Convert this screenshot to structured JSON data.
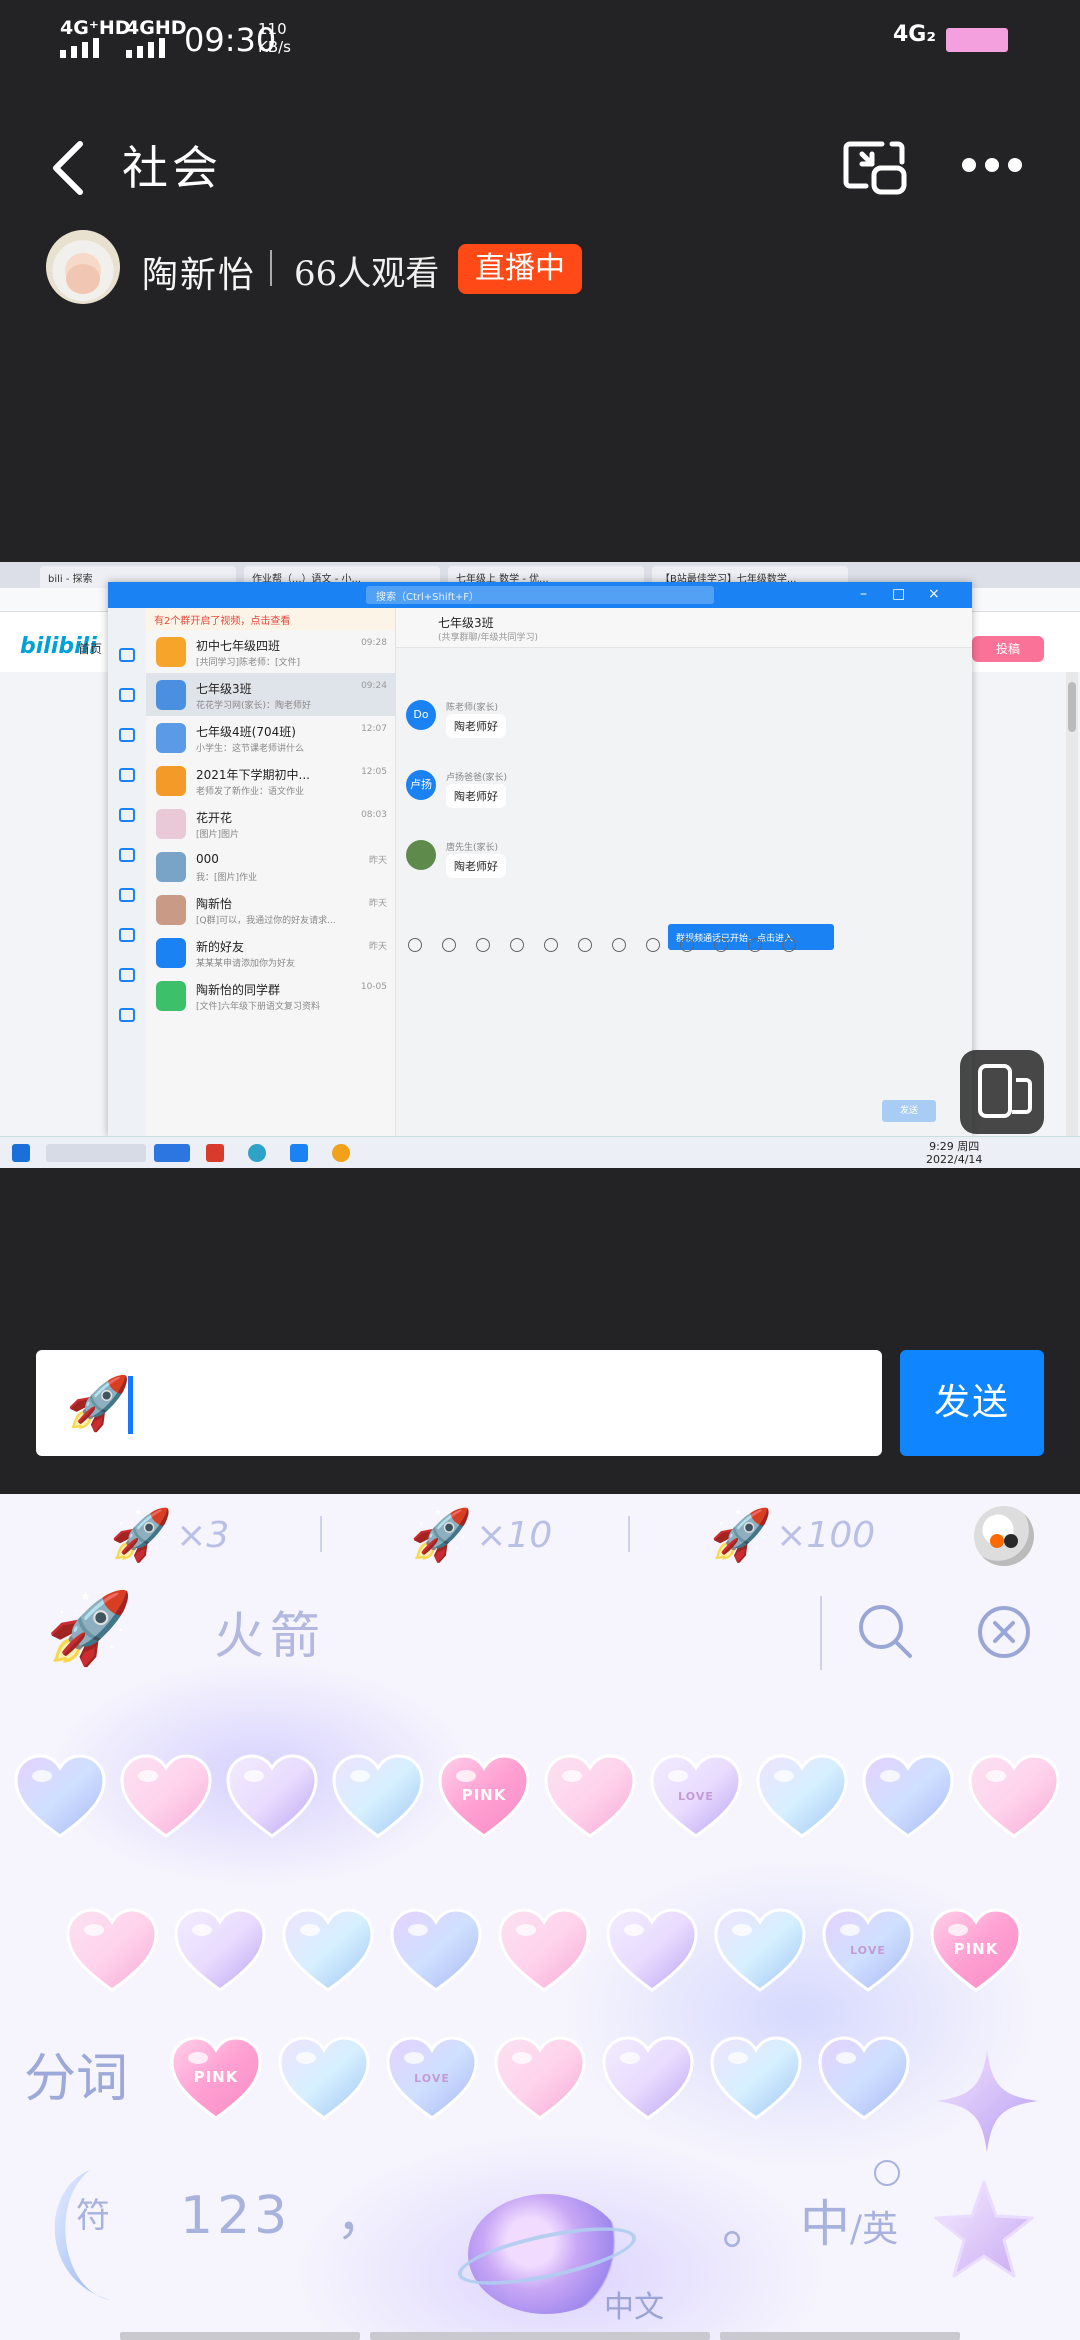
{
  "status_bar": {
    "net_left_1": "4G⁺HD",
    "net_left_2": "4GHD",
    "time": "09:30",
    "speed_value": "110",
    "speed_unit": "KB/s",
    "net_right": "4G₂",
    "battery_color": "#f4a0de"
  },
  "header": {
    "back_icon": "chevron-left-icon",
    "title": "社会",
    "pip_icon": "picture-in-picture-icon",
    "more_icon": "more-dots-icon"
  },
  "streamer": {
    "name": "陶新怡",
    "viewers": "66人观看",
    "live_badge": "直播中",
    "live_color": "#ff4a17"
  },
  "stream": {
    "browser_tabs": [
      "bili - 探索",
      "作业帮（...）语文 - 小...",
      "七年级上 数学 - 优...",
      "【B站最佳学习】七年级数学..."
    ],
    "bili_logo": "bilibili",
    "bili_home": "首页",
    "bili_upload": "投稿",
    "qq_search": "搜索（Ctrl+Shift+F）",
    "qq_list_notice": "有2个群开启了视频，点击查看",
    "chats": [
      {
        "name": "初中七年级四班",
        "msg": "[共同学习]陈老师：[文件]",
        "time": "09:28",
        "color": "#f7a42a"
      },
      {
        "name": "七年级3班",
        "msg": "花花学习网(家长)：陶老师好",
        "time": "09:24",
        "color": "#4b8fe0"
      },
      {
        "name": "七年级4班(704班)",
        "msg": "小学生：这节课老师讲什么",
        "time": "12:07",
        "color": "#5a9ae6"
      },
      {
        "name": "2021年下学期初中...",
        "msg": "老师发了新作业：语文作业",
        "time": "12:05",
        "color": "#f39a28"
      },
      {
        "name": "花开花",
        "msg": "[图片]图片",
        "time": "08:03",
        "color": "#e9c9d6"
      },
      {
        "name": "000",
        "msg": "我：[图片]作业",
        "time": "昨天",
        "color": "#7aa3c8"
      },
      {
        "name": "陶新怡",
        "msg": "[Q群]可以，我通过你的好友请求...",
        "time": "昨天",
        "color": "#c99a86"
      },
      {
        "name": "新的好友",
        "msg": "某某某申请添加你为好友",
        "time": "昨天",
        "color": "#1a82f2"
      },
      {
        "name": "陶新怡的同学群",
        "msg": "[文件]六年级下册语文复习资料",
        "time": "10-05",
        "color": "#3cc16a"
      }
    ],
    "chat_title": "七年级3班",
    "chat_subtitle": "(共享群聊/年级共同学习)",
    "messages": [
      {
        "avatar": "Do",
        "who": "陈老师(家长)",
        "text": "陶老师好"
      },
      {
        "avatar": "卢扬",
        "who": "卢扬爸爸(家长)",
        "text": "陶老师好"
      },
      {
        "avatar": "",
        "who": "唐先生(家长)",
        "text": "陶老师好"
      }
    ],
    "tip": "群视频通话已开始，点击进入",
    "send_small": "发送",
    "taskbar_time": "9:29 周四",
    "taskbar_date": "2022/4/14"
  },
  "input": {
    "value_icon": "🚀",
    "send": "发送"
  },
  "keyboard": {
    "combos": [
      {
        "icon": "🚀",
        "count": "×3"
      },
      {
        "icon": "🚀",
        "count": "×10"
      },
      {
        "icon": "🚀",
        "count": "×100"
      }
    ],
    "toolbar_icon": "keyboard-mascot-icon",
    "candidate_rocket": "🚀",
    "candidate_word": "火箭",
    "search_icon": "search-icon",
    "clear_icon": "clear-circle-icon",
    "sticker_row1": [
      "",
      "",
      "",
      "",
      "PINK",
      "",
      "LOVE",
      "",
      "",
      ""
    ],
    "sticker_row2": [
      "",
      "",
      "",
      "",
      "",
      "",
      "",
      "LOVE",
      "PINK"
    ],
    "sticker_row3": [
      "PINK",
      "",
      "LOVE",
      "",
      "",
      "",
      ""
    ],
    "fenci": "分词",
    "fu": "符",
    "num": "123",
    "comma": "，",
    "space_label": "中文",
    "period": "。",
    "lang_zh": "中",
    "lang_en": "/英"
  }
}
